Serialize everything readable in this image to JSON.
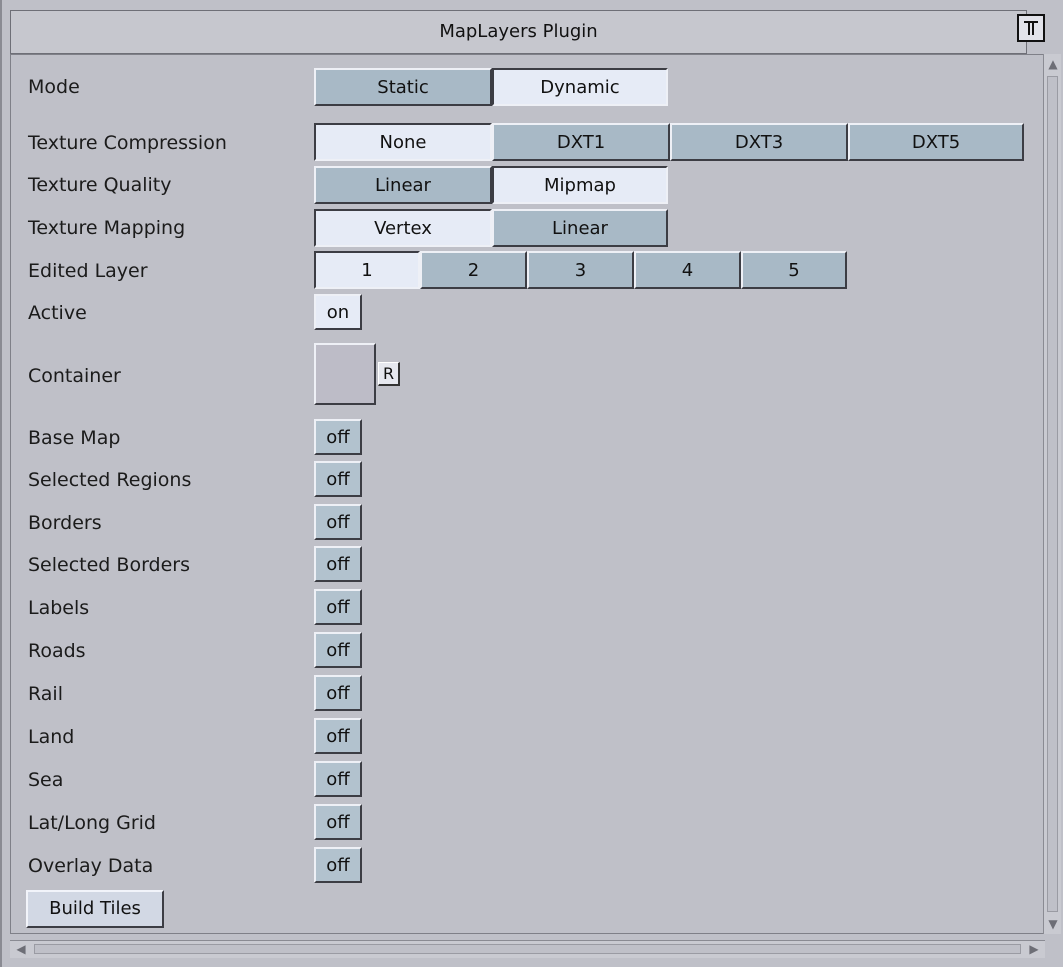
{
  "window": {
    "title": "MapLayers Plugin"
  },
  "icons": {
    "title_icon": "plugin-icon"
  },
  "rows": {
    "mode": {
      "label": "Mode",
      "options": [
        "Static",
        "Dynamic"
      ],
      "selected": "Dynamic"
    },
    "texture_compression": {
      "label": "Texture Compression",
      "options": [
        "None",
        "DXT1",
        "DXT3",
        "DXT5"
      ],
      "selected": "None"
    },
    "texture_quality": {
      "label": "Texture Quality",
      "options": [
        "Linear",
        "Mipmap"
      ],
      "selected": "Mipmap"
    },
    "texture_mapping": {
      "label": "Texture Mapping",
      "options": [
        "Vertex",
        "Linear"
      ],
      "selected": "Vertex"
    },
    "edited_layer": {
      "label": "Edited Layer",
      "options": [
        "1",
        "2",
        "3",
        "4",
        "5"
      ],
      "selected": "1"
    },
    "active": {
      "label": "Active",
      "value": "on"
    },
    "container": {
      "label": "Container",
      "reset_label": "R"
    }
  },
  "toggles": [
    {
      "label": "Base Map",
      "value": "off"
    },
    {
      "label": "Selected Regions",
      "value": "off"
    },
    {
      "label": "Borders",
      "value": "off"
    },
    {
      "label": "Selected Borders",
      "value": "off"
    },
    {
      "label": "Labels",
      "value": "off"
    },
    {
      "label": "Roads",
      "value": "off"
    },
    {
      "label": "Rail",
      "value": "off"
    },
    {
      "label": "Land",
      "value": "off"
    },
    {
      "label": "Sea",
      "value": "off"
    },
    {
      "label": "Lat/Long Grid",
      "value": "off"
    },
    {
      "label": "Overlay Data",
      "value": "off"
    }
  ],
  "actions": {
    "build_tiles": "Build Tiles"
  },
  "colors": {
    "button": "#a8b9c6",
    "button_selected": "#e6ebf6",
    "background": "#bfc0c8"
  }
}
